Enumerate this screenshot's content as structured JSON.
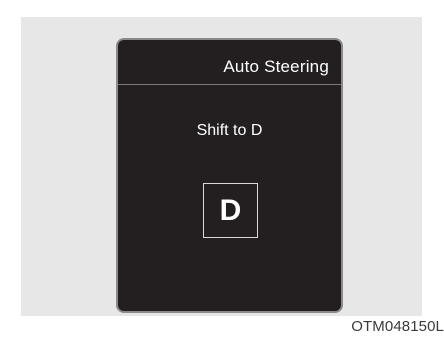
{
  "display": {
    "title": "Auto Steering",
    "message": "Shift to D",
    "gear_indicator": "D"
  },
  "figure": {
    "code": "OTM048150L"
  },
  "colors": {
    "cluster_background": "#231f20",
    "panel_background": "#e7e7e7",
    "text": "#ffffff"
  }
}
